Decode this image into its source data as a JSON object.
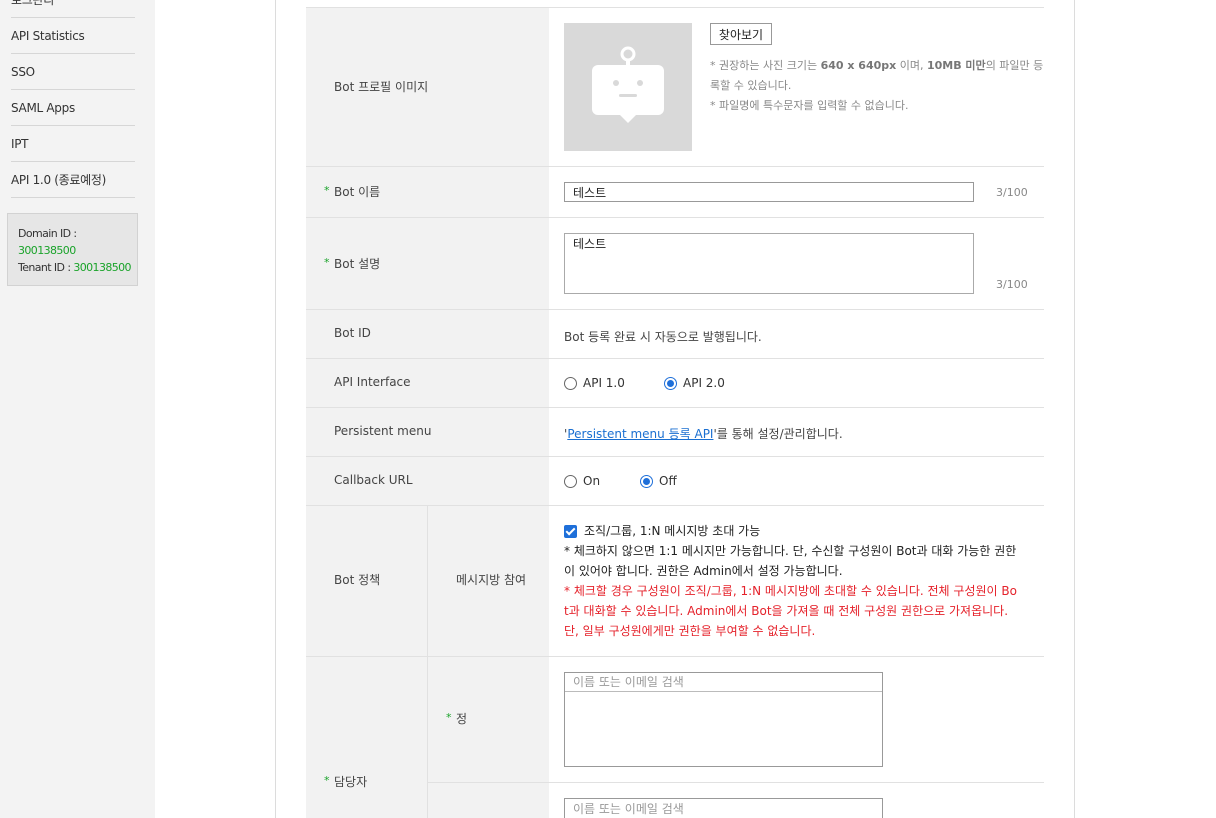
{
  "sidebar": {
    "items": [
      {
        "label": "로그관리"
      },
      {
        "label": "API Statistics"
      },
      {
        "label": "SSO"
      },
      {
        "label": "SAML Apps"
      },
      {
        "label": "IPT"
      },
      {
        "label": "API 1.0 (종료예정)"
      }
    ],
    "info": {
      "domain_label": "Domain ID :",
      "domain_value": "300138500",
      "tenant_label": "Tenant ID :",
      "tenant_value": "300138500"
    }
  },
  "form": {
    "profile_image": {
      "label": "Bot 프로필 이미지",
      "browse_label": "찾아보기",
      "hint1_a": "* 권장하는 사진 크기는 ",
      "hint1_b": "640 x 640px",
      "hint1_c": " 이며, ",
      "hint1_d": "10MB 미만",
      "hint1_e": "의 파일만 등",
      "hint1_f": "록할 수 있습니다.",
      "hint2": "* 파일명에 특수문자를 입력할 수 없습니다."
    },
    "bot_name": {
      "required_mark": "*",
      "label": "Bot 이름",
      "value": "테스트",
      "counter": "3/100"
    },
    "bot_desc": {
      "required_mark": "*",
      "label": "Bot 설명",
      "value": "테스트",
      "counter": "3/100"
    },
    "bot_id": {
      "label": "Bot ID",
      "value": "Bot 등록 완료 시 자동으로 발행됩니다."
    },
    "api_interface": {
      "label": "API Interface",
      "option1": "API 1.0",
      "option2": "API 2.0",
      "selected": "API 2.0"
    },
    "persistent_menu": {
      "label": "Persistent menu",
      "quote_open": "'",
      "link": "Persistent menu 등록 API",
      "suffix": "'를 통해 설정/관리합니다."
    },
    "callback_url": {
      "label": "Callback URL",
      "option1": "On",
      "option2": "Off",
      "selected": "Off"
    },
    "policy": {
      "label": "Bot 정책",
      "sub_label": "메시지방 참여",
      "checkbox_label": "조직/그룹, 1:N 메시지방 초대 가능",
      "checked": true,
      "note1": "* 체크하지 않으면 1:1 메시지만 가능합니다. 단, 수신할 구성원이 Bot과 대화 가능한 권한",
      "note2": "이 있어야 합니다. 권한은 Admin에서 설정 가능합니다.",
      "warn1": "* 체크할 경우 구성원이 조직/그룹, 1:N 메시지방에 초대할 수 있습니다. 전체 구성원이 Bo",
      "warn2": "t과 대화할 수 있습니다. Admin에서 Bot을 가져올 때 전체 구성원 권한으로 가져옵니다.",
      "warn3": "단, 일부 구성원에게만 권한을 부여할 수 없습니다."
    },
    "manager": {
      "required_mark": "*",
      "label": "담당자",
      "primary_label": "정",
      "search_placeholder": "이름 또는 이메일 검색"
    }
  },
  "colors": {
    "accent": "#1e6fd9",
    "required": "#1aa32a",
    "warning": "#e5222b",
    "link": "#1a6fd1"
  },
  "icons": {
    "placeholder": "bot-avatar-icon"
  }
}
